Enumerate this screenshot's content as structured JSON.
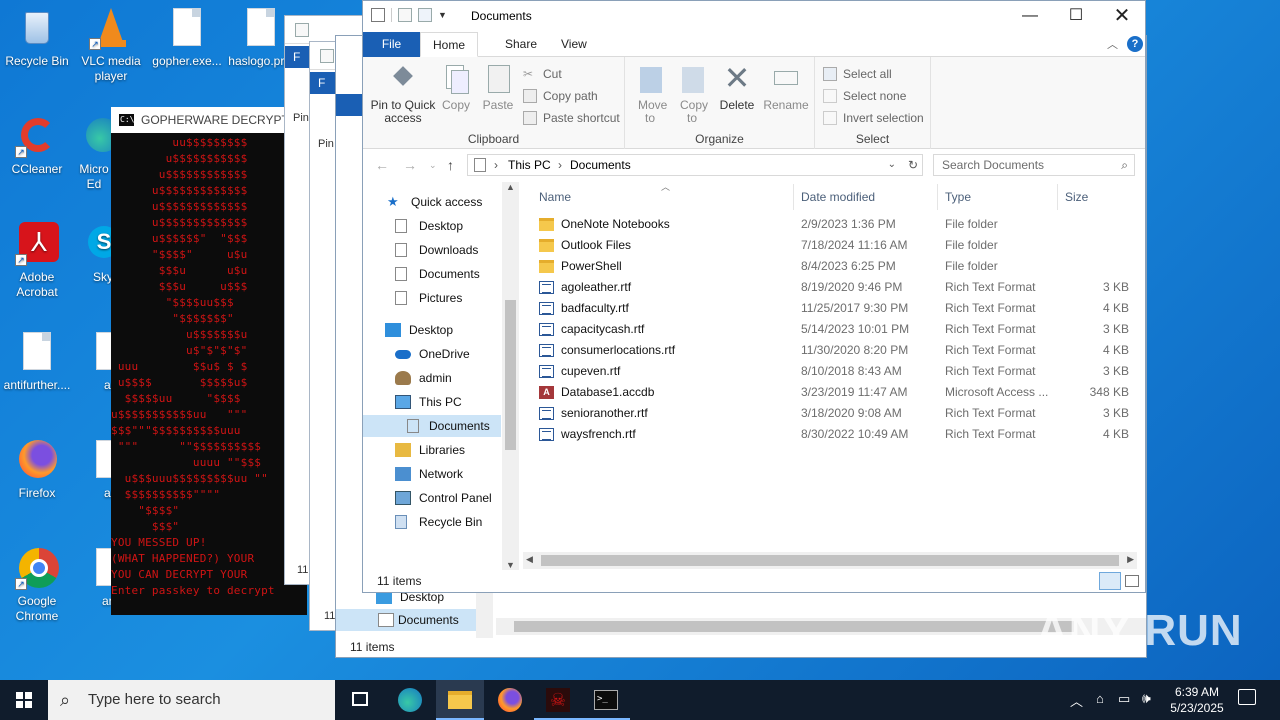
{
  "desktop": {
    "icons": [
      {
        "label": "Recycle Bin",
        "icon": "recycle-bin-icon"
      },
      {
        "label": "VLC media player",
        "icon": "vlc-icon"
      },
      {
        "label": "gopher.exe...",
        "icon": "file-icon"
      },
      {
        "label": "haslogo.pr...",
        "icon": "file-icon"
      },
      {
        "label": "CCleaner",
        "icon": "ccleaner-icon"
      },
      {
        "label": "Micro Ed",
        "icon": "edge-icon"
      },
      {
        "label": "Adobe Acrobat",
        "icon": "acrobat-icon"
      },
      {
        "label": "Sky",
        "icon": "skype-icon"
      },
      {
        "label": "antifurther....",
        "icon": "file-icon"
      },
      {
        "label": "antifur",
        "icon": "file-icon"
      },
      {
        "label": "Firefox",
        "icon": "firefox-icon"
      },
      {
        "label": "antifur",
        "icon": "file-icon"
      },
      {
        "label": "Google Chrome",
        "icon": "chrome-icon"
      },
      {
        "label": "artlife",
        "icon": "file-icon"
      }
    ]
  },
  "console": {
    "title": "GOPHERWARE DECRYPTOR",
    "art": "         uu$$$$$$$$$\n        u$$$$$$$$$$$\n       u$$$$$$$$$$$$\n      u$$$$$$$$$$$$$\n      u$$$$$$$$$$$$$\n      u$$$$$$$$$$$$$\n      u$$$$$$\"  \"$$$\n      \"$$$$\"     u$u\n       $$$u      u$u\n       $$$u     u$$$\n        \"$$$$uu$$$\n         \"$$$$$$$\"\n           u$$$$$$$u\n           u$\"$\"$\"$\"\n uuu        $$u$ $ $\n u$$$$       $$$$$u$\n  $$$$$uu     \"$$$$\nu$$$$$$$$$$$uu   \"\"\"\n$$$\"\"\"$$$$$$$$$$uuu\n \"\"\"      \"\"$$$$$$$$$$\n            uuuu \"\"$$$\n  u$$$uuu$$$$$$$$$uu \"\"\n  $$$$$$$$$$\"\"\"\"\n    \"$$$$\"\n      $$$\"",
    "lines": [
      "YOU MESSED UP!",
      "(WHAT HAPPENED?) YOUR",
      "YOU CAN DECRYPT YOUR",
      "",
      "Enter passkey to decrypt"
    ]
  },
  "stacked": {
    "tab_label": "F",
    "pin_label": "Pin",
    "status": "11"
  },
  "explorer": {
    "title": "Documents",
    "tabs": {
      "file": "File",
      "home": "Home",
      "share": "Share",
      "view": "View"
    },
    "ribbon": {
      "pin": "Pin to Quick access",
      "copy": "Copy",
      "paste": "Paste",
      "cut": "Cut",
      "copy_path": "Copy path",
      "paste_shortcut": "Paste shortcut",
      "clipboard": "Clipboard",
      "move_to": "Move to",
      "copy_to": "Copy to",
      "delete": "Delete",
      "rename": "Rename",
      "organize": "Organize",
      "select_all": "Select all",
      "select_none": "Select none",
      "invert_selection": "Invert selection",
      "select": "Select"
    },
    "address": {
      "this_pc": "This PC",
      "current": "Documents"
    },
    "search_placeholder": "Search Documents",
    "nav": [
      {
        "label": "Quick access",
        "icon": "star-icon"
      },
      {
        "label": "Desktop",
        "icon": "page-icon"
      },
      {
        "label": "Downloads",
        "icon": "page-icon"
      },
      {
        "label": "Documents",
        "icon": "page-icon"
      },
      {
        "label": "Pictures",
        "icon": "page-icon"
      },
      {
        "label": "Desktop",
        "icon": "desktop-icon"
      },
      {
        "label": "OneDrive",
        "icon": "cloud-icon"
      },
      {
        "label": "admin",
        "icon": "user-icon"
      },
      {
        "label": "This PC",
        "icon": "pc-icon"
      },
      {
        "label": "Documents",
        "icon": "page-icon"
      },
      {
        "label": "Libraries",
        "icon": "library-icon"
      },
      {
        "label": "Network",
        "icon": "network-icon"
      },
      {
        "label": "Control Panel",
        "icon": "control-panel-icon"
      },
      {
        "label": "Recycle Bin",
        "icon": "recycle-bin-icon"
      }
    ],
    "columns": {
      "name": "Name",
      "date": "Date modified",
      "type": "Type",
      "size": "Size"
    },
    "files": [
      {
        "name": "OneNote Notebooks",
        "date": "2/9/2023 1:36 PM",
        "type": "File folder",
        "size": "",
        "kind": "folder"
      },
      {
        "name": "Outlook Files",
        "date": "7/18/2024 11:16 AM",
        "type": "File folder",
        "size": "",
        "kind": "folder"
      },
      {
        "name": "PowerShell",
        "date": "8/4/2023 6:25 PM",
        "type": "File folder",
        "size": "",
        "kind": "folder"
      },
      {
        "name": "agoleather.rtf",
        "date": "8/19/2020 9:46 PM",
        "type": "Rich Text Format",
        "size": "3 KB",
        "kind": "rtf"
      },
      {
        "name": "badfaculty.rtf",
        "date": "11/25/2017 9:30 PM",
        "type": "Rich Text Format",
        "size": "4 KB",
        "kind": "rtf"
      },
      {
        "name": "capacitycash.rtf",
        "date": "5/14/2023 10:01 PM",
        "type": "Rich Text Format",
        "size": "3 KB",
        "kind": "rtf"
      },
      {
        "name": "consumerlocations.rtf",
        "date": "11/30/2020 8:20 PM",
        "type": "Rich Text Format",
        "size": "4 KB",
        "kind": "rtf"
      },
      {
        "name": "cupeven.rtf",
        "date": "8/10/2018 8:43 AM",
        "type": "Rich Text Format",
        "size": "3 KB",
        "kind": "rtf"
      },
      {
        "name": "Database1.accdb",
        "date": "3/23/2019 11:47 AM",
        "type": "Microsoft Access ...",
        "size": "348 KB",
        "kind": "accdb"
      },
      {
        "name": "senioranother.rtf",
        "date": "3/18/2020 9:08 AM",
        "type": "Rich Text Format",
        "size": "3 KB",
        "kind": "rtf"
      },
      {
        "name": "waysfrench.rtf",
        "date": "8/30/2022 10:49 AM",
        "type": "Rich Text Format",
        "size": "4 KB",
        "kind": "rtf"
      }
    ],
    "status": "11 items"
  },
  "backwin": {
    "nav": [
      {
        "label": "Desktop"
      },
      {
        "label": "Documents"
      }
    ],
    "status": "11 items"
  },
  "taskbar": {
    "search_placeholder": "Type here to search",
    "time": "6:39 AM",
    "date": "5/23/2025"
  },
  "watermark": "ANY RUN"
}
